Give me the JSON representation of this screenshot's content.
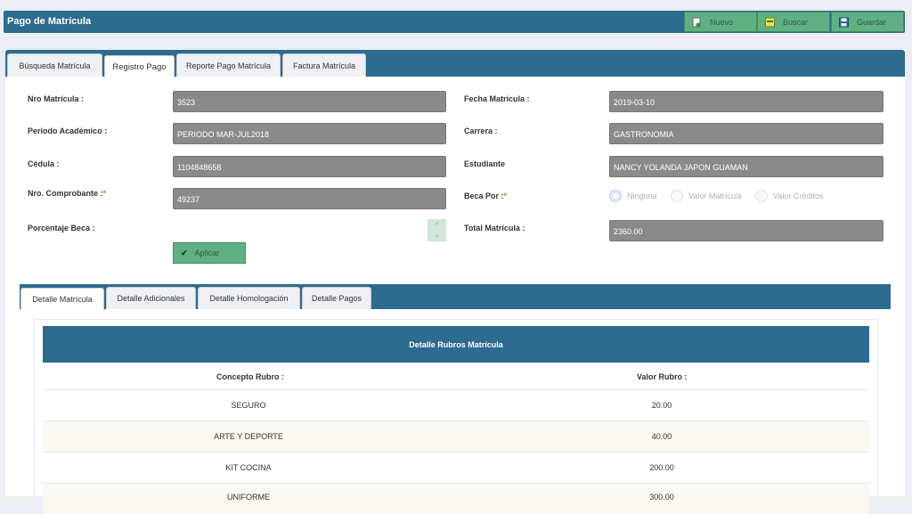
{
  "header": {
    "title": "Pago de Matrícula",
    "buttons": {
      "nuevo": "Nuevo",
      "buscar": "Buscar",
      "guardar": "Guardar"
    }
  },
  "tabs": [
    "Búsqueda Matrícula",
    "Registro Pago",
    "Reporte Pago Matrícula",
    "Factura Matrícula"
  ],
  "active_tab": "Registro Pago",
  "form": {
    "nro_matricula_label": "Nro Matrícula :",
    "nro_matricula": "3523",
    "fecha_matricula_label": "Fecha Matrícula :",
    "fecha_matricula": "2019-03-10",
    "periodo_label": "Periodo Académico :",
    "periodo": "PERIODO MAR-JUL2018",
    "carrera_label": "Carrera :",
    "carrera": "GASTRONOMIA",
    "cedula_label": "Cédula :",
    "cedula": "1104848658",
    "estudiante_label": "Estudiante",
    "estudiante": "NANCY YOLANDA  JAPON  GUAMAN",
    "comprobante_label": "Nro. Comprobante :",
    "comprobante": "49237",
    "required_mark": "*",
    "beca_por_label": "Beca Por :",
    "beca_options": [
      "Ninguna",
      "Valor Matrícula",
      "Valor Créditos"
    ],
    "beca_selected": "Ninguna",
    "porcentaje_label": "Porcentaje Beca :",
    "porcentaje": "",
    "total_label": "Total Matrícula :",
    "total": "2360.00",
    "aplicar": "Aplicar"
  },
  "sub_tabs": [
    "Detalle Matrícula",
    "Detalle Adicionales",
    "Detalle Homologación",
    "Detalle Pagos"
  ],
  "active_sub_tab": "Detalle Matrícula",
  "table": {
    "title": "Detalle Rubros Matrícula",
    "columns": [
      "Concepto Rubro :",
      "Valor Rubro :"
    ],
    "rows": [
      [
        "SEGURO",
        "20.00"
      ],
      [
        "ARTE Y DEPORTE",
        "40.00"
      ],
      [
        "KIT COCINA",
        "200.00"
      ],
      [
        "UNIFORME",
        "300.00"
      ]
    ]
  },
  "colors": {
    "header_blue": "#2d6b8f",
    "button_green": "#5fb083",
    "field_gray": "#8a8a8a",
    "alt_row": "#faf8f0"
  }
}
